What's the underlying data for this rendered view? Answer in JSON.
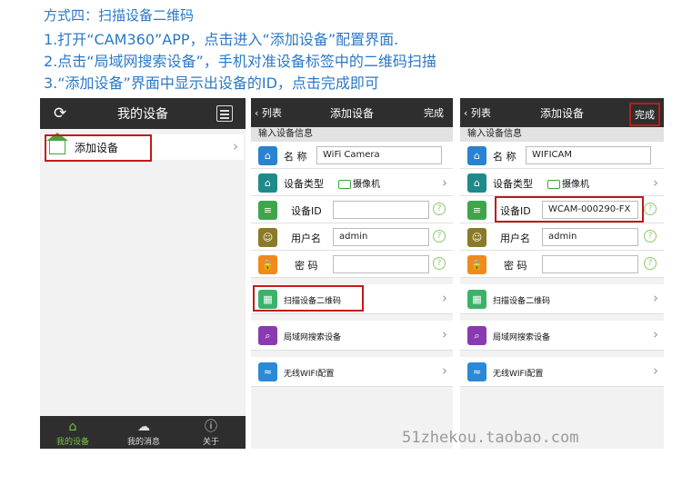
{
  "instructions": {
    "title": "方式四：扫描设备二维码",
    "step1": "1.打开“CAM360”APP，点击进入“添加设备”配置界面.",
    "step2": "2.点击“局域网搜索设备”，手机对准设备标签中的二维码扫描",
    "step3": "3.“添加设备”界面中显示出设备的ID，点击完成即可"
  },
  "screen1": {
    "title": "我的设备",
    "add_device": "添加设备",
    "tabs": [
      {
        "label": "我的设备",
        "icon": "home-icon"
      },
      {
        "label": "我的消息",
        "icon": "cloud-icon"
      },
      {
        "label": "关于",
        "icon": "info-icon"
      }
    ]
  },
  "screen2": {
    "back": "列表",
    "title": "添加设备",
    "done": "完成",
    "section": "输入设备信息",
    "name_label": "名 称",
    "name_value": "WiFi Camera",
    "type_label": "设备类型",
    "type_value": "摄像机",
    "id_label": "设备ID",
    "id_value": "",
    "user_label": "用户名",
    "user_value": "admin",
    "pwd_label": "密 码",
    "pwd_value": "",
    "scan": "扫描设备二维码",
    "lan": "局域网搜索设备",
    "wifi": "无线WIFI配置"
  },
  "screen3": {
    "back": "列表",
    "title": "添加设备",
    "done": "完成",
    "section": "输入设备信息",
    "name_label": "名 称",
    "name_value": "WIFICAM",
    "type_label": "设备类型",
    "type_value": "摄像机",
    "id_label": "设备ID",
    "id_value": "WCAM-000290-FX",
    "user_label": "用户名",
    "user_value": "admin",
    "pwd_label": "密 码",
    "pwd_value": "",
    "scan": "扫描设备二维码",
    "lan": "局域网搜索设备",
    "wifi": "无线WIFI配置"
  },
  "help_glyph": "?",
  "watermark": "51zhekou.taobao.com"
}
